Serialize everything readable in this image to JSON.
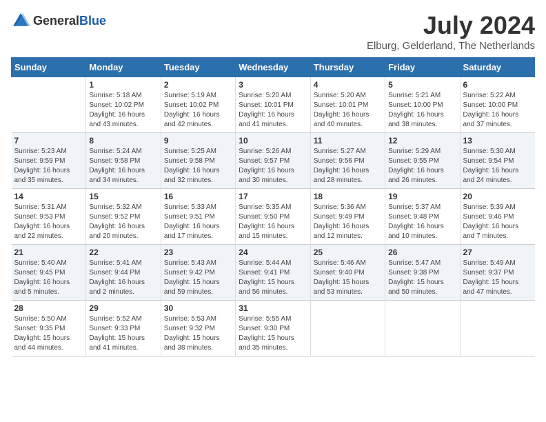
{
  "logo": {
    "general": "General",
    "blue": "Blue"
  },
  "title": "July 2024",
  "location": "Elburg, Gelderland, The Netherlands",
  "days_header": [
    "Sunday",
    "Monday",
    "Tuesday",
    "Wednesday",
    "Thursday",
    "Friday",
    "Saturday"
  ],
  "weeks": [
    [
      {
        "num": "",
        "info": ""
      },
      {
        "num": "1",
        "info": "Sunrise: 5:18 AM\nSunset: 10:02 PM\nDaylight: 16 hours\nand 43 minutes."
      },
      {
        "num": "2",
        "info": "Sunrise: 5:19 AM\nSunset: 10:02 PM\nDaylight: 16 hours\nand 42 minutes."
      },
      {
        "num": "3",
        "info": "Sunrise: 5:20 AM\nSunset: 10:01 PM\nDaylight: 16 hours\nand 41 minutes."
      },
      {
        "num": "4",
        "info": "Sunrise: 5:20 AM\nSunset: 10:01 PM\nDaylight: 16 hours\nand 40 minutes."
      },
      {
        "num": "5",
        "info": "Sunrise: 5:21 AM\nSunset: 10:00 PM\nDaylight: 16 hours\nand 38 minutes."
      },
      {
        "num": "6",
        "info": "Sunrise: 5:22 AM\nSunset: 10:00 PM\nDaylight: 16 hours\nand 37 minutes."
      }
    ],
    [
      {
        "num": "7",
        "info": "Sunrise: 5:23 AM\nSunset: 9:59 PM\nDaylight: 16 hours\nand 35 minutes."
      },
      {
        "num": "8",
        "info": "Sunrise: 5:24 AM\nSunset: 9:58 PM\nDaylight: 16 hours\nand 34 minutes."
      },
      {
        "num": "9",
        "info": "Sunrise: 5:25 AM\nSunset: 9:58 PM\nDaylight: 16 hours\nand 32 minutes."
      },
      {
        "num": "10",
        "info": "Sunrise: 5:26 AM\nSunset: 9:57 PM\nDaylight: 16 hours\nand 30 minutes."
      },
      {
        "num": "11",
        "info": "Sunrise: 5:27 AM\nSunset: 9:56 PM\nDaylight: 16 hours\nand 28 minutes."
      },
      {
        "num": "12",
        "info": "Sunrise: 5:29 AM\nSunset: 9:55 PM\nDaylight: 16 hours\nand 26 minutes."
      },
      {
        "num": "13",
        "info": "Sunrise: 5:30 AM\nSunset: 9:54 PM\nDaylight: 16 hours\nand 24 minutes."
      }
    ],
    [
      {
        "num": "14",
        "info": "Sunrise: 5:31 AM\nSunset: 9:53 PM\nDaylight: 16 hours\nand 22 minutes."
      },
      {
        "num": "15",
        "info": "Sunrise: 5:32 AM\nSunset: 9:52 PM\nDaylight: 16 hours\nand 20 minutes."
      },
      {
        "num": "16",
        "info": "Sunrise: 5:33 AM\nSunset: 9:51 PM\nDaylight: 16 hours\nand 17 minutes."
      },
      {
        "num": "17",
        "info": "Sunrise: 5:35 AM\nSunset: 9:50 PM\nDaylight: 16 hours\nand 15 minutes."
      },
      {
        "num": "18",
        "info": "Sunrise: 5:36 AM\nSunset: 9:49 PM\nDaylight: 16 hours\nand 12 minutes."
      },
      {
        "num": "19",
        "info": "Sunrise: 5:37 AM\nSunset: 9:48 PM\nDaylight: 16 hours\nand 10 minutes."
      },
      {
        "num": "20",
        "info": "Sunrise: 5:39 AM\nSunset: 9:46 PM\nDaylight: 16 hours\nand 7 minutes."
      }
    ],
    [
      {
        "num": "21",
        "info": "Sunrise: 5:40 AM\nSunset: 9:45 PM\nDaylight: 16 hours\nand 5 minutes."
      },
      {
        "num": "22",
        "info": "Sunrise: 5:41 AM\nSunset: 9:44 PM\nDaylight: 16 hours\nand 2 minutes."
      },
      {
        "num": "23",
        "info": "Sunrise: 5:43 AM\nSunset: 9:42 PM\nDaylight: 15 hours\nand 59 minutes."
      },
      {
        "num": "24",
        "info": "Sunrise: 5:44 AM\nSunset: 9:41 PM\nDaylight: 15 hours\nand 56 minutes."
      },
      {
        "num": "25",
        "info": "Sunrise: 5:46 AM\nSunset: 9:40 PM\nDaylight: 15 hours\nand 53 minutes."
      },
      {
        "num": "26",
        "info": "Sunrise: 5:47 AM\nSunset: 9:38 PM\nDaylight: 15 hours\nand 50 minutes."
      },
      {
        "num": "27",
        "info": "Sunrise: 5:49 AM\nSunset: 9:37 PM\nDaylight: 15 hours\nand 47 minutes."
      }
    ],
    [
      {
        "num": "28",
        "info": "Sunrise: 5:50 AM\nSunset: 9:35 PM\nDaylight: 15 hours\nand 44 minutes."
      },
      {
        "num": "29",
        "info": "Sunrise: 5:52 AM\nSunset: 9:33 PM\nDaylight: 15 hours\nand 41 minutes."
      },
      {
        "num": "30",
        "info": "Sunrise: 5:53 AM\nSunset: 9:32 PM\nDaylight: 15 hours\nand 38 minutes."
      },
      {
        "num": "31",
        "info": "Sunrise: 5:55 AM\nSunset: 9:30 PM\nDaylight: 15 hours\nand 35 minutes."
      },
      {
        "num": "",
        "info": ""
      },
      {
        "num": "",
        "info": ""
      },
      {
        "num": "",
        "info": ""
      }
    ]
  ]
}
